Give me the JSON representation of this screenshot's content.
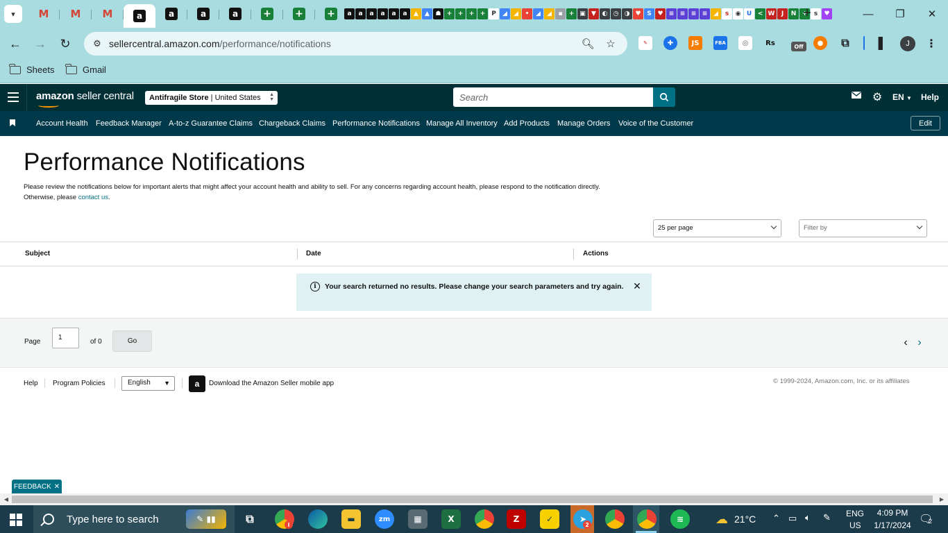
{
  "browser": {
    "url_host": "sellercentral.amazon.com",
    "url_path": "/performance/notifications",
    "tabs": [
      {
        "favicon": "gmail-icon",
        "label": "M"
      },
      {
        "favicon": "gmail-icon",
        "label": "M"
      },
      {
        "favicon": "gmail-icon",
        "label": "M"
      },
      {
        "favicon": "amazon-icon",
        "label": "a",
        "active": true
      },
      {
        "favicon": "amazon-icon",
        "label": "a"
      },
      {
        "favicon": "amazon-icon",
        "label": "a"
      },
      {
        "favicon": "amazon-icon",
        "label": "a"
      },
      {
        "favicon": "sheets-icon",
        "label": "+"
      },
      {
        "favicon": "sheets-icon",
        "label": "+"
      },
      {
        "favicon": "sheets-icon",
        "label": "+"
      }
    ],
    "bookmarks": [
      {
        "label": "Sheets"
      },
      {
        "label": "Gmail"
      }
    ],
    "extensions": {
      "js_label": "JS",
      "fba_label": "FBA",
      "rs_label": "Rs",
      "off_label": "Off"
    },
    "profile_initial": "J"
  },
  "header": {
    "logo_bold": "amazon",
    "logo_rest": " seller central",
    "store_name": "Antifragile Store",
    "store_sep": " | ",
    "store_region": "United States",
    "search_placeholder": "Search",
    "language": "EN",
    "help": "Help"
  },
  "nav": {
    "items": [
      "Account Health",
      "Feedback Manager",
      "A-to-z Guarantee Claims",
      "Chargeback Claims",
      "Performance Notifications",
      "Manage All Inventory",
      "Add Products",
      "Manage Orders",
      "Voice of the Customer"
    ],
    "edit": "Edit"
  },
  "page": {
    "title": "Performance Notifications",
    "description": "Please review the notifications below for important alerts that might affect your account health and ability to sell. For any concerns regarding account health, please respond to the notification directly. Otherwise, please ",
    "contact_link": "contact us",
    "description_end": ".",
    "per_page": "25 per page",
    "filter_placeholder": "Filter by"
  },
  "table": {
    "columns": [
      "Subject",
      "Date",
      "Actions"
    ],
    "empty_message": "Your search returned no results. Please change your search parameters and try again."
  },
  "pager": {
    "page_label": "Page",
    "page_value": "1",
    "of_label": "of 0",
    "go_label": "Go"
  },
  "footer": {
    "help": "Help",
    "program_policies": "Program Policies",
    "language": "English",
    "app_text": "Download the Amazon Seller mobile app",
    "copyright": "© 1999-2024, Amazon.com, Inc. or its affiliates"
  },
  "feedback": {
    "label": "FEEDBACK"
  },
  "taskbar": {
    "search_placeholder": "Type here to search",
    "chrome_badge": "i",
    "zoom_label": "zm",
    "telegram_badge": "2",
    "weather": "21°C",
    "lang_top": "ENG",
    "lang_bottom": "US",
    "time": "4:09 PM",
    "date": "1/17/2024",
    "notifications": "2"
  },
  "colors": {
    "header_bg": "#002f36",
    "nav_bg": "#00394a",
    "accent": "#007185",
    "alert_bg": "#dff1f3",
    "browser_frame": "#a8dce0"
  }
}
